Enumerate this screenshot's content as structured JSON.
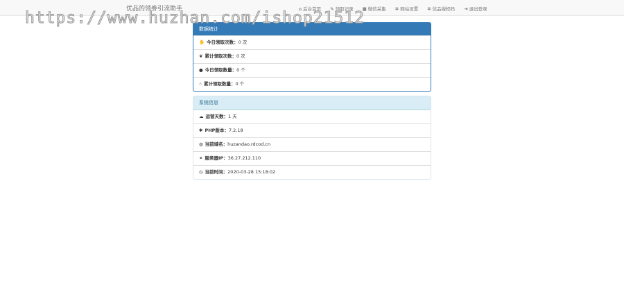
{
  "watermark": "https://www.huzhan.com/ishop21512",
  "header": {
    "title": "优品的领劵引流助手",
    "menu": [
      {
        "icon": "home-icon",
        "glyph": "⌂",
        "label": "后台首页"
      },
      {
        "icon": "pencil-icon",
        "glyph": "✎",
        "label": "领取记录"
      },
      {
        "icon": "grid-icon",
        "glyph": "▦",
        "label": "微信采集"
      },
      {
        "icon": "gear-icon",
        "glyph": "✲",
        "label": "网站设置"
      },
      {
        "icon": "gear-icon",
        "glyph": "✲",
        "label": "优品授权码"
      },
      {
        "icon": "logout-icon",
        "glyph": "⇥",
        "label": "退出登录"
      }
    ]
  },
  "stats": {
    "title": "数据统计",
    "rows": [
      {
        "glyph": "✋",
        "label": "今日领取次数：",
        "value": "0 次"
      },
      {
        "glyph": "❦",
        "label": "累计领取次数：",
        "value": "0 次"
      },
      {
        "glyph": "●",
        "label": "今日领取数量：",
        "value": "0 个"
      },
      {
        "glyph": "☝",
        "label": "累计领取数量：",
        "value": "0 个"
      }
    ]
  },
  "system": {
    "title": "系统信息",
    "rows": [
      {
        "glyph": "☁",
        "label": "运营天数：",
        "value": "1 天"
      },
      {
        "glyph": "✱",
        "label": "PHP版本：",
        "value": "7.2.18"
      },
      {
        "glyph": "◍",
        "label": "当前域名：",
        "value": "huzandao.rdcod.cn"
      },
      {
        "glyph": "⚭",
        "label": "服务器IP：",
        "value": "36.27.212.110"
      },
      {
        "glyph": "◷",
        "label": "当前时间：",
        "value": "2020-03-28 15:18:02"
      }
    ]
  }
}
